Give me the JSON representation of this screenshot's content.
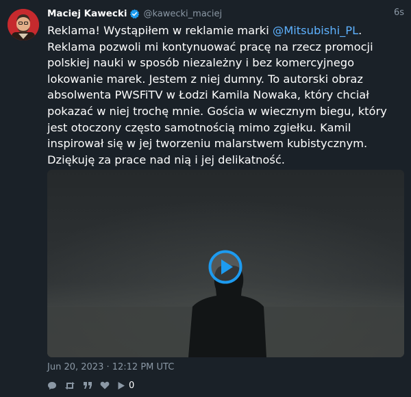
{
  "author": {
    "name": "Maciej Kawecki",
    "handle": "@kawecki_maciej",
    "verified": true
  },
  "timestamp_relative": "6s",
  "tweet": {
    "text_before": "Reklama! Wystąpiłem w reklamie marki ",
    "mention": "@Mitsubishi_PL",
    "text_after": ". Reklama pozwoli mi kontynuować pracę na rzecz promocji polskiej nauki w sposób niezależny i bez komercyjnego lokowanie marek. Jestem z niej dumny. To autorski obraz absolwenta PWSFiTV w Łodzi Kamila Nowaka, który chciał pokazać w niej trochę mnie. Gościa w wiecznym biegu, który jest otoczony często samotnością mimo zgiełku. Kamil inspirował się w jej tworzeniu malarstwem kubistycznym. Dziękuję za prace nad nią i jej delikatność."
  },
  "date": "Jun 20, 2023 · 12:12 PM UTC",
  "stats": {
    "play_count": "0"
  },
  "icons": {
    "reply": "comment-icon",
    "retweet": "retweet-icon",
    "quote": "quote-icon",
    "like": "heart-icon",
    "views": "play-views-icon",
    "video": "play-button-icon",
    "verified": "verified-badge-icon"
  },
  "colors": {
    "background": "#1a2128",
    "link": "#5eb2ff",
    "muted": "#8b98a5",
    "verified": "#1d9bf0",
    "play_button": "#1d9bf0"
  }
}
